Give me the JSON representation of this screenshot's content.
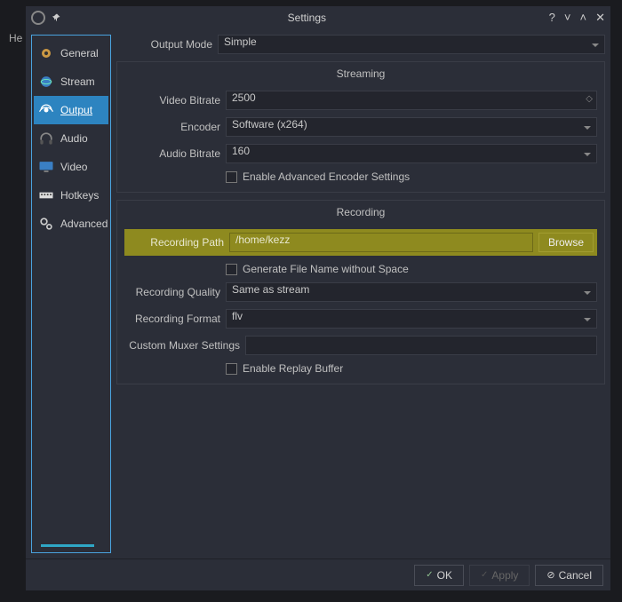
{
  "heText": "He",
  "window": {
    "title": "Settings",
    "buttons": {
      "help": "?",
      "min": "˅",
      "max": "˄",
      "close": "✕"
    }
  },
  "sidebar": {
    "items": [
      {
        "label": "General"
      },
      {
        "label": "Stream"
      },
      {
        "label": "Output"
      },
      {
        "label": "Audio"
      },
      {
        "label": "Video"
      },
      {
        "label": "Hotkeys"
      },
      {
        "label": "Advanced"
      }
    ],
    "activeIndex": 2
  },
  "main": {
    "outputMode": {
      "label": "Output Mode",
      "value": "Simple"
    },
    "streaming": {
      "title": "Streaming",
      "videoBitrate": {
        "label": "Video Bitrate",
        "value": "2500"
      },
      "encoder": {
        "label": "Encoder",
        "value": "Software (x264)"
      },
      "audioBitrate": {
        "label": "Audio Bitrate",
        "value": "160"
      },
      "enableAdvanced": {
        "label": "Enable Advanced Encoder Settings",
        "checked": false
      }
    },
    "recording": {
      "title": "Recording",
      "recordingPath": {
        "label": "Recording Path",
        "value": "/home/kezz",
        "browse": "Browse"
      },
      "generateNoSpace": {
        "label": "Generate File Name without Space",
        "checked": false
      },
      "quality": {
        "label": "Recording Quality",
        "value": "Same as stream"
      },
      "format": {
        "label": "Recording Format",
        "value": "flv"
      },
      "muxer": {
        "label": "Custom Muxer Settings",
        "value": ""
      },
      "enableReplay": {
        "label": "Enable Replay Buffer",
        "checked": false
      }
    }
  },
  "footer": {
    "ok": "OK",
    "apply": "Apply",
    "cancel": "Cancel"
  }
}
